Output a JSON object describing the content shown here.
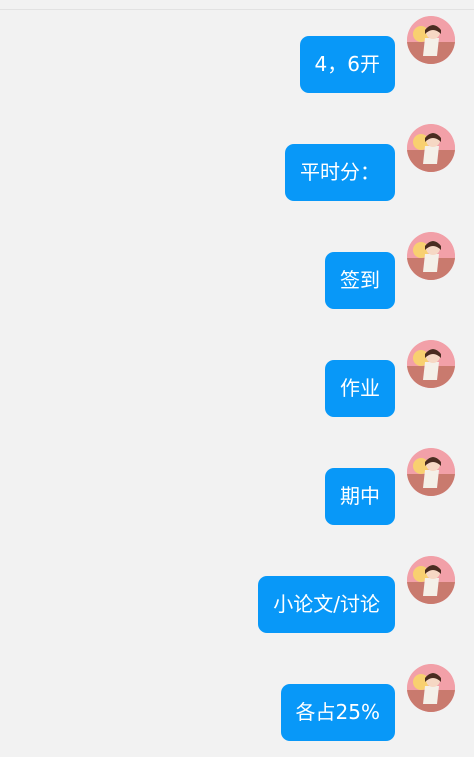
{
  "messages": [
    {
      "text": "4，6开"
    },
    {
      "text": "平时分："
    },
    {
      "text": "签到"
    },
    {
      "text": "作业"
    },
    {
      "text": "期中"
    },
    {
      "text": "小论文/讨论"
    },
    {
      "text": "各占25%"
    }
  ],
  "colors": {
    "background": "#f2f2f2",
    "bubble": "#0898f8",
    "bubble_text": "#ffffff"
  },
  "icons": {
    "avatar": "user-avatar-anime-character-icon"
  }
}
